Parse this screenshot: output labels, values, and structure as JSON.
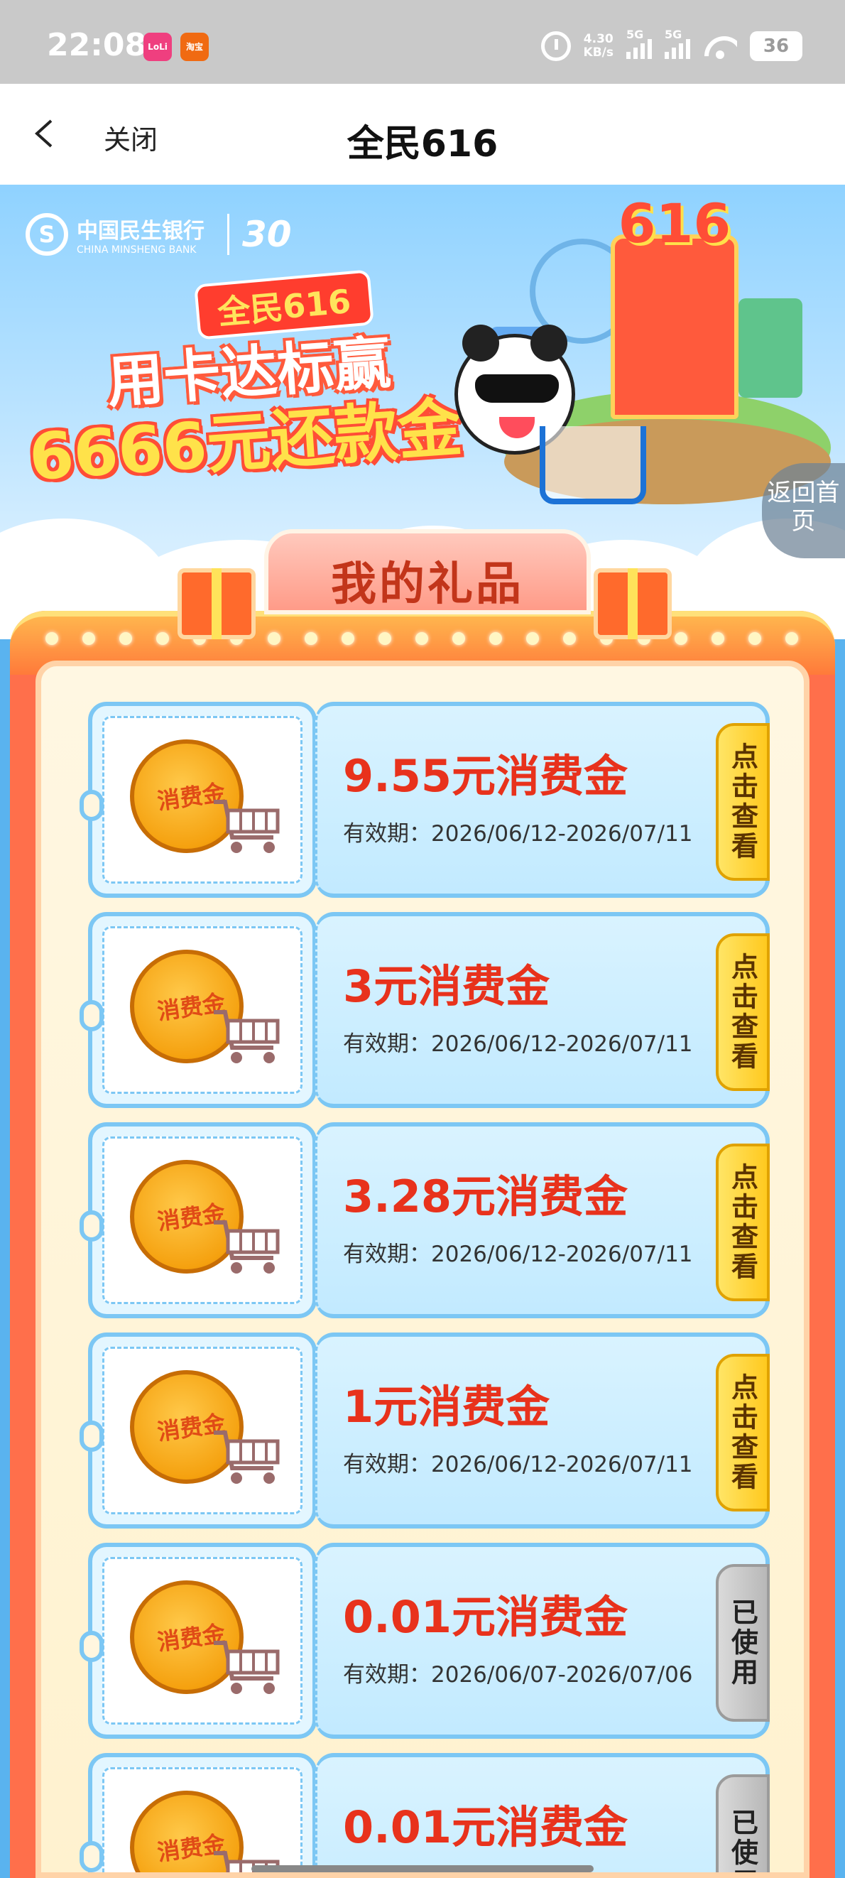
{
  "status_bar": {
    "time": "22:08",
    "badge_a": "LoLi",
    "badge_b": "淘宝",
    "net_speed_value": "4.30",
    "net_speed_unit": "KB/s",
    "signal_label_1": "5G",
    "signal_label_2": "5G",
    "battery": "36"
  },
  "nav": {
    "close_label": "关闭",
    "title": "全民616"
  },
  "hero": {
    "bank_name_cn": "中国民生银行",
    "bank_name_en": "CHINA MINSHENG BANK",
    "anniversary": "30",
    "campaign_tag": "全民616",
    "slogan_line1": "用卡达标赢",
    "slogan_line2": "6666元还款金",
    "mall_sign": "616",
    "back_home": "返回首页"
  },
  "gifts": {
    "title": "我的礼品",
    "coin_label": "消费金",
    "coupons": [
      {
        "amount": "9.55元消费金",
        "validity": "有效期：2026/06/12-2026/07/11",
        "action": "点击查看",
        "state": "active"
      },
      {
        "amount": "3元消费金",
        "validity": "有效期：2026/06/12-2026/07/11",
        "action": "点击查看",
        "state": "active"
      },
      {
        "amount": "3.28元消费金",
        "validity": "有效期：2026/06/12-2026/07/11",
        "action": "点击查看",
        "state": "active"
      },
      {
        "amount": "1元消费金",
        "validity": "有效期：2026/06/12-2026/07/11",
        "action": "点击查看",
        "state": "active"
      },
      {
        "amount": "0.01元消费金",
        "validity": "有效期：2026/06/07-2026/07/06",
        "action": "已使用",
        "state": "used"
      },
      {
        "amount": "0.01元消费金",
        "validity": "",
        "action": "已使用",
        "state": "used"
      }
    ]
  },
  "colors": {
    "amount_red": "#e8321c",
    "card_border_blue": "#7cc7f4",
    "frame_orange": "#ff6f4b",
    "button_yellow": "#ffc91f",
    "button_used_gray": "#b8b8b8"
  },
  "icons": [
    "back-chevron-icon",
    "alarm-icon",
    "signal-icon",
    "wifi-icon",
    "battery-icon",
    "coin-icon",
    "shopping-cart-icon",
    "gift-box-icon",
    "panda-mascot"
  ]
}
